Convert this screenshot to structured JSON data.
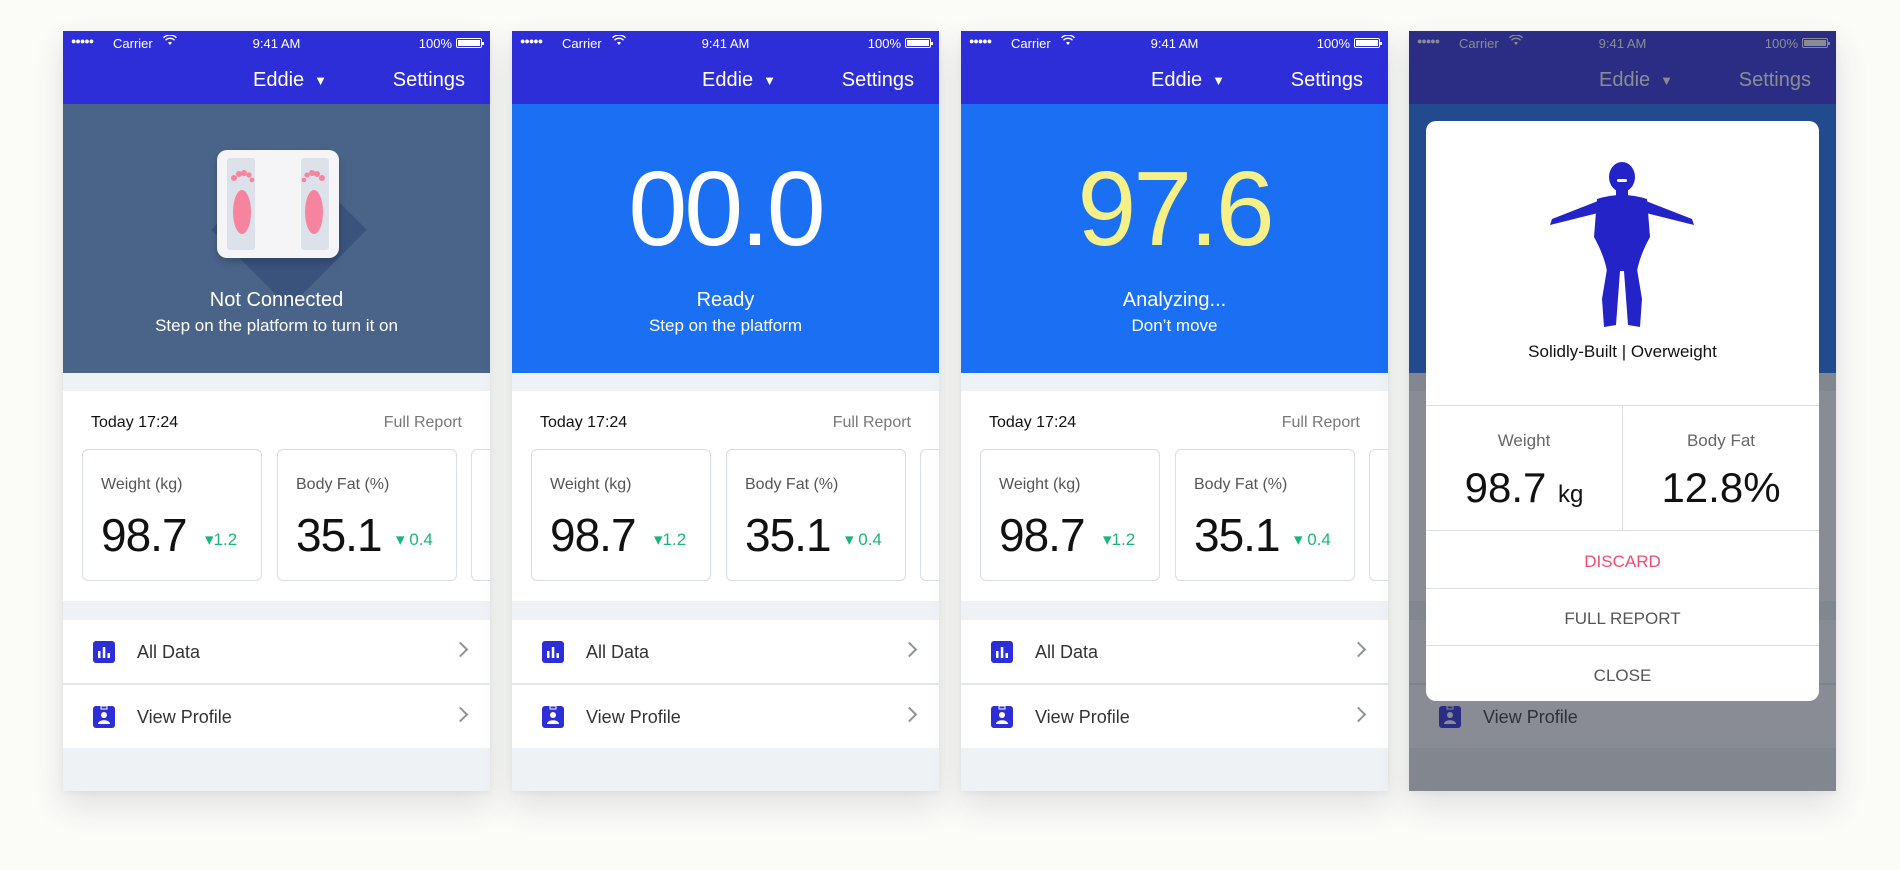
{
  "status": {
    "carrier": "Carrier",
    "time": "9:41 AM",
    "battery": "100%"
  },
  "nav": {
    "user": "Eddie",
    "settings": "Settings"
  },
  "screens": [
    {
      "title": "Not Connected",
      "subtitle": "Step on the platform to turn it on"
    },
    {
      "reading": "00.0",
      "title": "Ready",
      "subtitle": "Step on the platform"
    },
    {
      "reading": "97.6",
      "title": "Analyzing...",
      "subtitle": "Don’t move"
    },
    {}
  ],
  "summary": {
    "date": "Today 17:24",
    "full_report": "Full Report",
    "metrics": [
      {
        "label": "Weight (kg)",
        "value": "98.7",
        "delta": "▾1.2"
      },
      {
        "label": "Body Fat (%)",
        "value": "35.1",
        "delta": "▾ 0.4"
      }
    ]
  },
  "menu": {
    "all_data": "All Data",
    "view_profile": "View Profile"
  },
  "modal": {
    "body_type": "Solidly-Built | Overweight",
    "weight_label": "Weight",
    "weight_value": "98.7",
    "weight_unit": "kg",
    "fat_label": "Body Fat",
    "fat_value": "12.8%",
    "discard": "DISCARD",
    "full_report": "FULL REPORT",
    "close": "CLOSE"
  },
  "colors": {
    "nav_blue": "#2e2ed9",
    "hero_dark": "#4a6489",
    "hero_blue": "#1a6ff2",
    "reading_yellow": "#f6f088",
    "delta_green": "#1bb57a",
    "discard_pink": "#f04a72",
    "foot_pink": "#f7849e"
  },
  "icons": [
    "signal-icon",
    "wifi-icon",
    "battery-icon",
    "caret-down-icon",
    "scale-icon",
    "foot-icon",
    "bar-chart-icon",
    "profile-icon",
    "chevron-right-icon",
    "body-figure-icon"
  ]
}
